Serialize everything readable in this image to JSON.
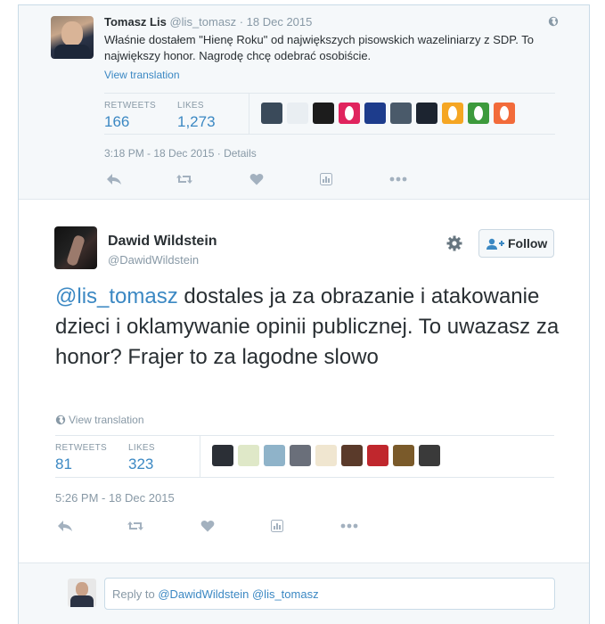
{
  "parent_tweet": {
    "name": "Tomasz Lis",
    "handle": "@lis_tomasz",
    "date_sep": " · ",
    "date": "18 Dec 2015",
    "text": "Właśnie dostałem \"Hienę Roku\" od największych pisowskich wazeliniarzy z SDP. To największy honor. Nagrodę chcę odebrać osobiście.",
    "view_translation": "View translation",
    "retweets_label": "RETWEETS",
    "retweets": "166",
    "likes_label": "LIKES",
    "likes": "1,273",
    "timestamp": "3:18 PM - 18 Dec 2015",
    "details_sep": " · ",
    "details": "Details",
    "liker_avatars": [
      {
        "name": "liker-avatar",
        "color": "#3a4a5a"
      },
      {
        "name": "liker-avatar",
        "color": "#e9eef2"
      },
      {
        "name": "liker-avatar",
        "color": "#1c1c1c"
      },
      {
        "name": "liker-avatar-egg",
        "color": "#e0245e"
      },
      {
        "name": "liker-avatar",
        "color": "#1d3c8c"
      },
      {
        "name": "liker-avatar",
        "color": "#4a5a6a"
      },
      {
        "name": "liker-avatar",
        "color": "#1c2430"
      },
      {
        "name": "liker-avatar-egg",
        "color": "#f5a623"
      },
      {
        "name": "liker-avatar-egg",
        "color": "#3c9a3c"
      },
      {
        "name": "liker-avatar-egg",
        "color": "#f26b3a"
      }
    ]
  },
  "main_tweet": {
    "name": "Dawid Wildstein",
    "handle": "@DawidWildstein",
    "follow_label": "Follow",
    "text_mention": "@lis_tomasz",
    "text_body": " dostales ja za obrazanie i atakowanie dzieci i oklamywanie opinii publicznej. To uwazasz za honor? Frajer to za lagodne slowo",
    "view_translation": "View translation",
    "retweets_label": "RETWEETS",
    "retweets": "81",
    "likes_label": "LIKES",
    "likes": "323",
    "timestamp": "5:26 PM - 18 Dec 2015",
    "liker_avatars": [
      {
        "name": "liker-avatar",
        "color": "#2b2f36"
      },
      {
        "name": "liker-avatar",
        "color": "#dfe8c8"
      },
      {
        "name": "liker-avatar",
        "color": "#8fb3c9"
      },
      {
        "name": "liker-avatar",
        "color": "#6a6f7a"
      },
      {
        "name": "liker-avatar",
        "color": "#f0e6d0"
      },
      {
        "name": "liker-avatar",
        "color": "#5a3a2a"
      },
      {
        "name": "liker-avatar",
        "color": "#c0272d"
      },
      {
        "name": "liker-avatar",
        "color": "#7a5a2a"
      },
      {
        "name": "liker-avatar",
        "color": "#3a3a3a"
      }
    ]
  },
  "reply": {
    "prefix": "Reply to ",
    "mentions": "@DawidWildstein @lis_tomasz"
  },
  "icons": [
    "globe-icon",
    "reply-icon",
    "retweet-icon",
    "like-icon",
    "analytics-icon",
    "more-icon",
    "gear-icon",
    "follow-user-icon"
  ],
  "colors": {
    "accent": "#3b88c3",
    "muted": "#8899a6",
    "text": "#292f33",
    "border": "#e1e8ed",
    "background_alt": "#f5f8fa"
  }
}
